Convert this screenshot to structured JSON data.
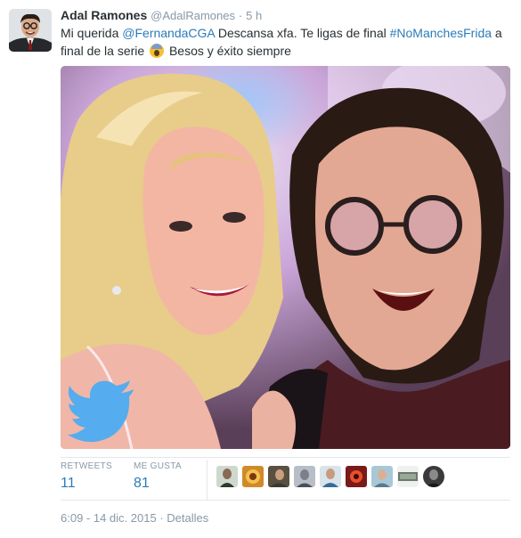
{
  "tweet": {
    "author_name": "Adal Ramones",
    "author_handle": "@AdalRamones",
    "separator": "·",
    "relative_time": "5 h",
    "text_part1": "Mi querida ",
    "mention": "@FernandaCGA",
    "text_part2": " Descansa xfa. Te ligas de final ",
    "hashtag": "#NoManchesFrida",
    "text_part3": " a final de la serie ",
    "emoji_icon": "fearful-face-emoji",
    "text_part4": " Besos y éxito siempre"
  },
  "stats": {
    "retweets_label": "RETWEETS",
    "retweets_value": "11",
    "likes_label": "ME GUSTA",
    "likes_value": "81"
  },
  "likers": {
    "count": 10
  },
  "footer": {
    "timestamp": "6:09 - 14 dic. 2015",
    "separator": "·",
    "details_link": "Detalles"
  },
  "colors": {
    "link": "#2b7bb9",
    "muted": "#8899a6",
    "text": "#292f33",
    "twitter_blue": "#55acee"
  }
}
